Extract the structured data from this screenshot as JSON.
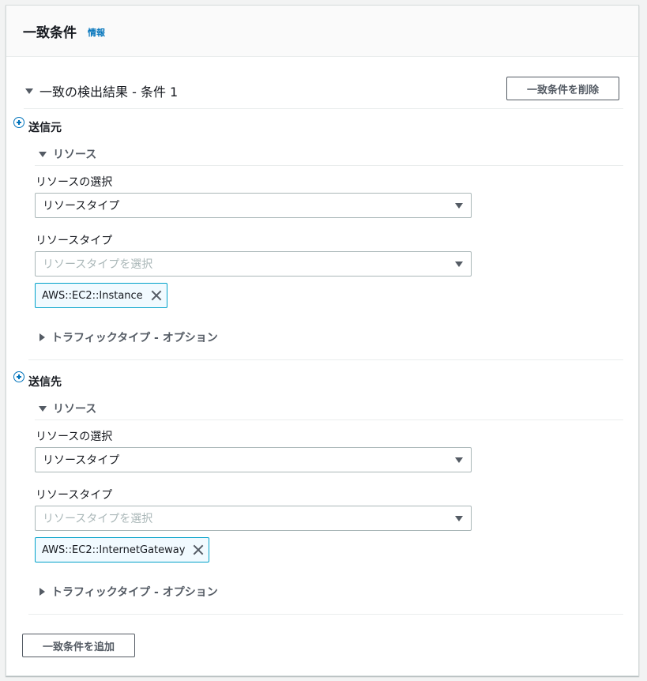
{
  "panel": {
    "title": "一致条件",
    "info_link": "情報"
  },
  "condition": {
    "header": "一致の検出結果 - 条件 1",
    "remove_button": "一致条件を削除"
  },
  "source": {
    "title": "送信元",
    "resource_expander": "リソース",
    "select_label": "リソースの選択",
    "select_value": "リソースタイプ",
    "type_label": "リソースタイプ",
    "type_placeholder": "リソースタイプを選択",
    "token": "AWS::EC2::Instance",
    "traffic_expander": "トラフィックタイプ - オプション"
  },
  "destination": {
    "title": "送信先",
    "resource_expander": "リソース",
    "select_label": "リソースの選択",
    "select_value": "リソースタイプ",
    "type_label": "リソースタイプ",
    "type_placeholder": "リソースタイプを選択",
    "token": "AWS::EC2::InternetGateway",
    "traffic_expander": "トラフィックタイプ - オプション"
  },
  "add_button": "一致条件を追加",
  "colors": {
    "link": "#0073bb",
    "token_border": "#00a1c9",
    "token_bg": "#f1faff"
  }
}
